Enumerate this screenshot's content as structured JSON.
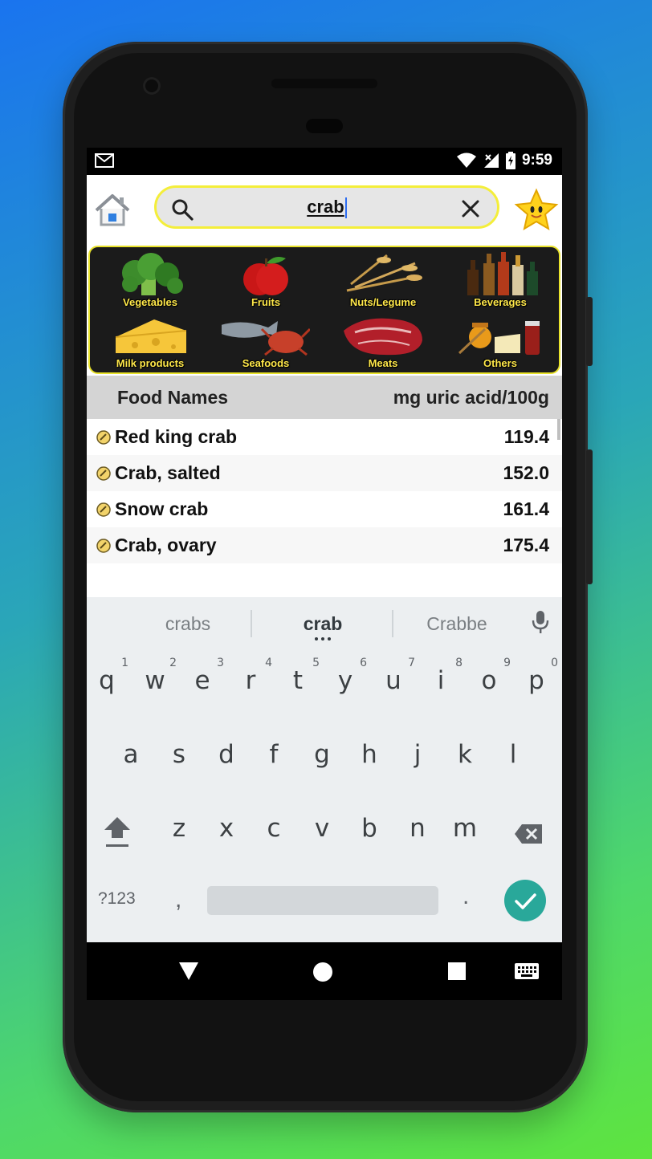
{
  "status_bar": {
    "time": "9:59",
    "notification_icon": "gmail-icon",
    "icons": [
      "wifi-icon",
      "no-signal-icon",
      "battery-icon"
    ]
  },
  "topbar": {
    "home_icon": "home-icon",
    "search_value": "crab",
    "favorite_icon": "star-icon"
  },
  "categories": [
    {
      "label": "Vegetables",
      "icon": "broccoli-icon"
    },
    {
      "label": "Fruits",
      "icon": "apple-icon"
    },
    {
      "label": "Nuts/Legume",
      "icon": "wheat-icon"
    },
    {
      "label": "Beverages",
      "icon": "bottles-icon"
    },
    {
      "label": "Milk products",
      "icon": "cheese-icon"
    },
    {
      "label": "Seafoods",
      "icon": "fish-crab-icon"
    },
    {
      "label": "Meats",
      "icon": "steak-icon"
    },
    {
      "label": "Others",
      "icon": "honey-icon"
    }
  ],
  "table": {
    "col_name": "Food Names",
    "col_value": "mg uric acid/100g",
    "rows": [
      {
        "name": "Red king crab",
        "value": "119.4"
      },
      {
        "name": "Crab, salted",
        "value": "152.0"
      },
      {
        "name": "Snow crab",
        "value": "161.4"
      },
      {
        "name": "Crab, ovary",
        "value": "175.4"
      }
    ]
  },
  "keyboard": {
    "suggestions": [
      "crabs",
      "crab",
      "Crabbe"
    ],
    "row1": [
      "q",
      "w",
      "e",
      "r",
      "t",
      "y",
      "u",
      "i",
      "o",
      "p"
    ],
    "row1_hints": [
      "1",
      "2",
      "3",
      "4",
      "5",
      "6",
      "7",
      "8",
      "9",
      "0"
    ],
    "row2": [
      "a",
      "s",
      "d",
      "f",
      "g",
      "h",
      "j",
      "k",
      "l"
    ],
    "row3": [
      "z",
      "x",
      "c",
      "v",
      "b",
      "n",
      "m"
    ],
    "symbols_key": "?123",
    "comma_key": ",",
    "period_key": "."
  },
  "colors": {
    "accent_yellow": "#f4ee3a",
    "enter_teal": "#29a89a",
    "header_gray": "#d4d4d4"
  }
}
